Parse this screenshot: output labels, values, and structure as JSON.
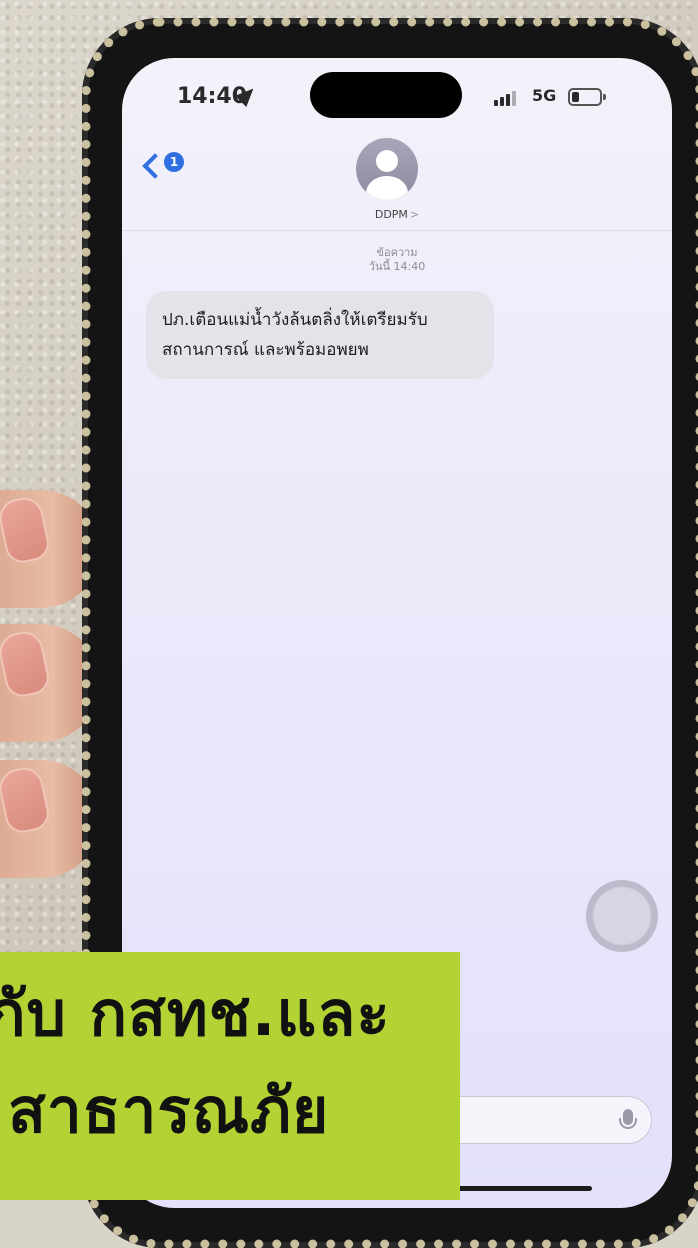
{
  "status_bar": {
    "time": "14:40",
    "network": "5G"
  },
  "header": {
    "unread_count": "1",
    "contact_name": "DDPM",
    "contact_chevron": ">"
  },
  "conversation": {
    "meta_label": "ข้อความ",
    "meta_time": "วันนี้ 14:40",
    "message_line_1": "ปภ.เตือนแม่น้ำวังล้นตลิ่งให้เตรียมรับ",
    "message_line_2": "สถานการณ์ และพร้อมอพยพ"
  },
  "caption": {
    "line_1": "กับ กสทช.และ",
    "line_2": "สาธารณภัย"
  },
  "colors": {
    "accent_blue": "#2f6fe0",
    "caption_bg": "#b3d334"
  }
}
